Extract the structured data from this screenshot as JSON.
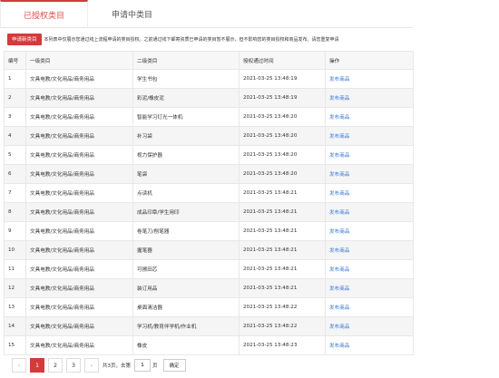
{
  "tabs": [
    {
      "label": "已授权类目"
    },
    {
      "label": "申请中类目"
    }
  ],
  "notice": {
    "apply_button": "申请新类目",
    "text": "本列表中仅展示您通过线上流程申请的类目授权。之前通过线下邮寄资质已申请的类目暂不展示，但不影响您的类目授权和商品发布。请您重复申请"
  },
  "table": {
    "headers": [
      "编号",
      "一级类目",
      "二级类目",
      "授权通过时间",
      "操作"
    ],
    "rows": [
      {
        "no": "1",
        "cat1": "文具电教/文化用品/商务用品",
        "cat2": "学生书包",
        "time": "2021-03-25 13:48:19",
        "op": "发布商品"
      },
      {
        "no": "2",
        "cat1": "文具电教/文化用品/商务用品",
        "cat2": "彩泥/橡皮泥",
        "time": "2021-03-25 13:48:19",
        "op": "发布商品"
      },
      {
        "no": "3",
        "cat1": "文具电教/文化用品/商务用品",
        "cat2": "智能学习灯光一体机",
        "time": "2021-03-25 13:48:20",
        "op": "发布商品"
      },
      {
        "no": "4",
        "cat1": "文具电教/文化用品/商务用品",
        "cat2": "补习袋",
        "time": "2021-03-25 13:48:20",
        "op": "发布商品"
      },
      {
        "no": "5",
        "cat1": "文具电教/文化用品/商务用品",
        "cat2": "视力保护器",
        "time": "2021-03-25 13:48:20",
        "op": "发布商品"
      },
      {
        "no": "6",
        "cat1": "文具电教/文化用品/商务用品",
        "cat2": "笔袋",
        "time": "2021-03-25 13:48:20",
        "op": "发布商品"
      },
      {
        "no": "7",
        "cat1": "文具电教/文化用品/商务用品",
        "cat2": "点读机",
        "time": "2021-03-25 13:48:21",
        "op": "发布商品"
      },
      {
        "no": "8",
        "cat1": "文具电教/文化用品/商务用品",
        "cat2": "成品印章/学生用印",
        "time": "2021-03-25 13:48:21",
        "op": "发布商品"
      },
      {
        "no": "9",
        "cat1": "文具电教/文化用品/商务用品",
        "cat2": "卷笔刀/削笔器",
        "time": "2021-03-25 13:48:21",
        "op": "发布商品"
      },
      {
        "no": "10",
        "cat1": "文具电教/文化用品/商务用品",
        "cat2": "握笔器",
        "time": "2021-03-25 13:48:21",
        "op": "发布商品"
      },
      {
        "no": "11",
        "cat1": "文具电教/文化用品/商务用品",
        "cat2": "可擦田芯",
        "time": "2021-03-25 13:48:21",
        "op": "发布商品"
      },
      {
        "no": "12",
        "cat1": "文具电教/文化用品/商务用品",
        "cat2": "装订用品",
        "time": "2021-03-25 13:48:21",
        "op": "发布商品"
      },
      {
        "no": "13",
        "cat1": "文具电教/文化用品/商务用品",
        "cat2": "桌面清洁器",
        "time": "2021-03-25 13:48:22",
        "op": "发布商品"
      },
      {
        "no": "14",
        "cat1": "文具电教/文化用品/商务用品",
        "cat2": "学习机/教育伴学机/作业机",
        "time": "2021-03-25 13:48:22",
        "op": "发布商品"
      },
      {
        "no": "15",
        "cat1": "文具电教/文化用品/商务用品",
        "cat2": "橡皮",
        "time": "2021-03-25 13:48:23",
        "op": "发布商品"
      }
    ]
  },
  "pager": {
    "prev": "‹",
    "pages": [
      "1",
      "2",
      "3"
    ],
    "next": "›",
    "total": "共3页，去第",
    "page_value": "1",
    "page_unit": "页",
    "confirm": "确定"
  },
  "colors": {
    "accent": "#d33b3b",
    "link": "#3a7bd5"
  }
}
